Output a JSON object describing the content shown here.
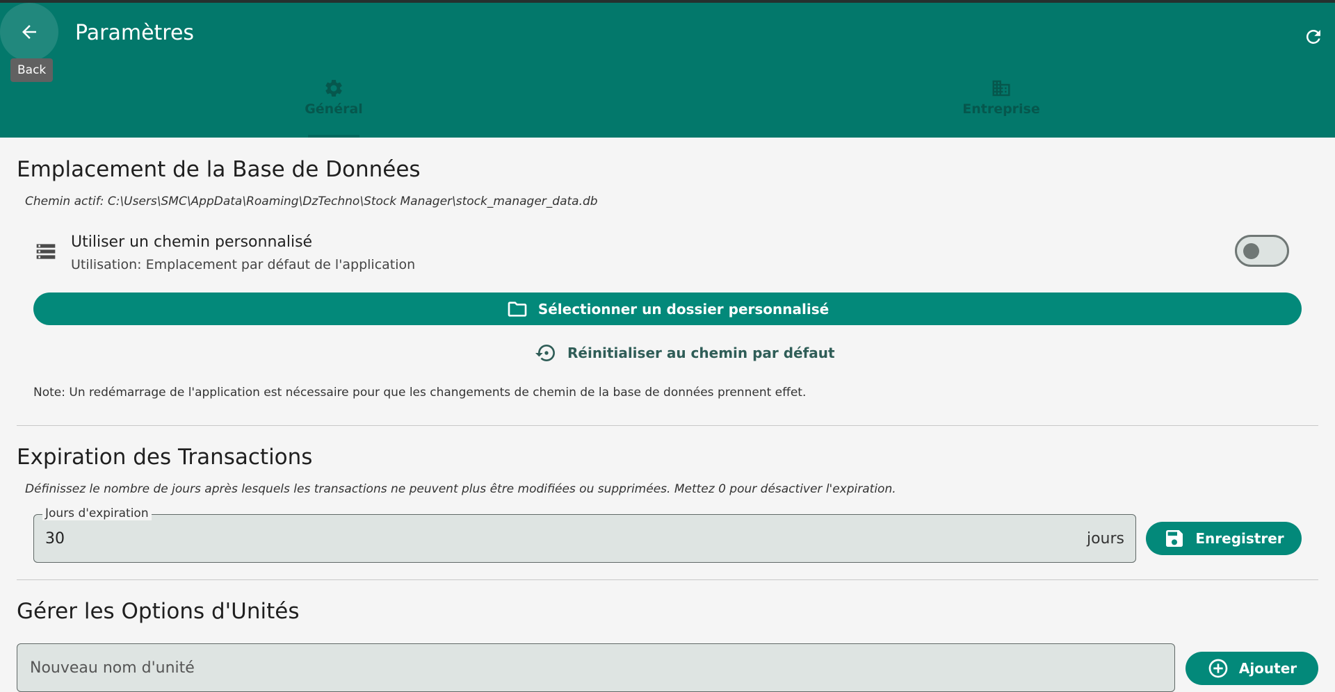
{
  "appbar": {
    "title": "Paramètres",
    "back_tooltip": "Back",
    "back_icon": "arrow-left-icon",
    "refresh_icon": "refresh-icon",
    "background": "#03786b"
  },
  "tabs": [
    {
      "label": "Général",
      "icon": "gear-icon",
      "selected": true
    },
    {
      "label": "Entreprise",
      "icon": "building-icon",
      "selected": false
    }
  ],
  "database": {
    "title": "Emplacement de la Base de Données",
    "active_path": "Chemin actif: C:\\Users\\SMC\\AppData\\Roaming\\DzTechno\\Stock Manager\\stock_manager_data.db",
    "custom_path_title": "Utiliser un chemin personnalisé",
    "custom_path_subtitle": "Utilisation: Emplacement par défaut de l'application",
    "custom_path_enabled": false,
    "select_folder_label": "Sélectionner un dossier personnalisé",
    "reset_label": "Réinitialiser au chemin par défaut",
    "note": "Note: Un redémarrage de l'application est nécessaire pour que les changements de chemin de la base de données prennent effet."
  },
  "expiration": {
    "title": "Expiration des Transactions",
    "description": "Définissez le nombre de jours après lesquels les transactions ne peuvent plus être modifiées ou supprimées. Mettez 0 pour désactiver l'expiration.",
    "field_label": "Jours d'expiration",
    "value": "30",
    "suffix": "jours",
    "save_label": "Enregistrer"
  },
  "units": {
    "title": "Gérer les Options d'Unités",
    "placeholder": "Nouveau nom d'unité",
    "add_label": "Ajouter"
  }
}
